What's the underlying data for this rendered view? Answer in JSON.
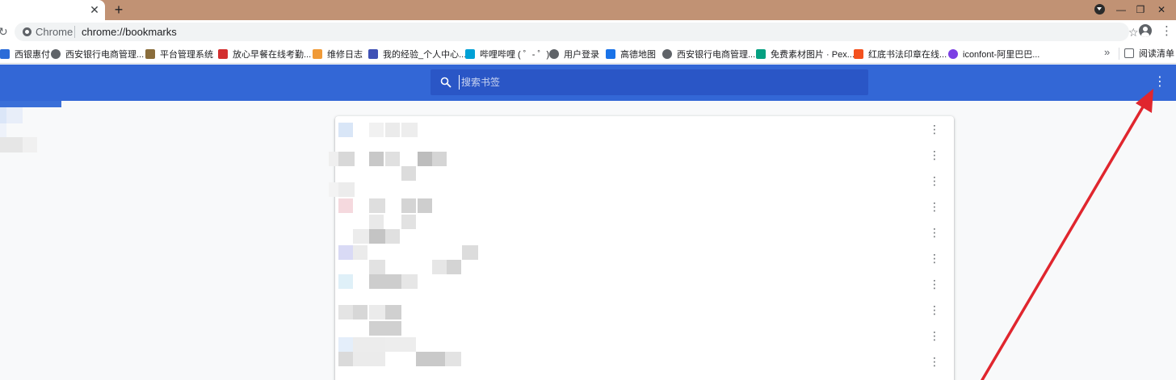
{
  "tabbar": {
    "close_glyph": "✕",
    "new_tab_glyph": "+",
    "window_controls": [
      "—",
      "❐",
      "✕"
    ]
  },
  "toolbar": {
    "omnibox_label": "Chrome",
    "url": "chrome://bookmarks"
  },
  "bookmarks_bar": {
    "items": [
      {
        "label": "西银惠付",
        "icon": "bank-icon",
        "color": "#2b6cd8"
      },
      {
        "label": "西安银行电商管理...",
        "icon": "globe-icon",
        "color": "#5f6368"
      },
      {
        "label": "平台管理系统",
        "icon": "chart-icon",
        "color": "#8a6d3b"
      },
      {
        "label": "放心早餐在线考勤...",
        "icon": "brand-icon",
        "color": "#d32f2f"
      },
      {
        "label": "维修日志",
        "icon": "swirl-icon",
        "color": "#f09a37"
      },
      {
        "label": "我的经验_个人中心...",
        "icon": "paw-icon",
        "color": "#3f51b5"
      },
      {
        "label": "哔哩哔哩 ( ゜- ゜)",
        "icon": "tv-icon",
        "color": "#00a1d6"
      },
      {
        "label": "用户登录",
        "icon": "globe-icon",
        "color": "#5f6368"
      },
      {
        "label": "高德地图",
        "icon": "navigation-icon",
        "color": "#1a73e8"
      },
      {
        "label": "西安银行电商管理...",
        "icon": "globe-icon",
        "color": "#5f6368"
      },
      {
        "label": "免费素材图片 · Pex...",
        "icon": "pexels-icon",
        "color": "#05a081"
      },
      {
        "label": "红底书法印章在线...",
        "icon": "brush-icon",
        "color": "#f4511e"
      },
      {
        "label": "iconfont-阿里巴巴...",
        "icon": "iconfont-icon",
        "color": "#7b3fe4"
      }
    ],
    "more_glyph": "»",
    "reading_list_label": "阅读清单"
  },
  "header": {
    "search_placeholder": "搜索书签",
    "menu_glyph": "⋮"
  },
  "colors": {
    "header_bg": "#3367d6",
    "search_bg": "#2a56c6",
    "tabstrip_bg": "#c19274",
    "annotation_arrow": "#e0262e"
  },
  "list": {
    "row_menu_glyph": "⋮",
    "row_count": 10
  }
}
